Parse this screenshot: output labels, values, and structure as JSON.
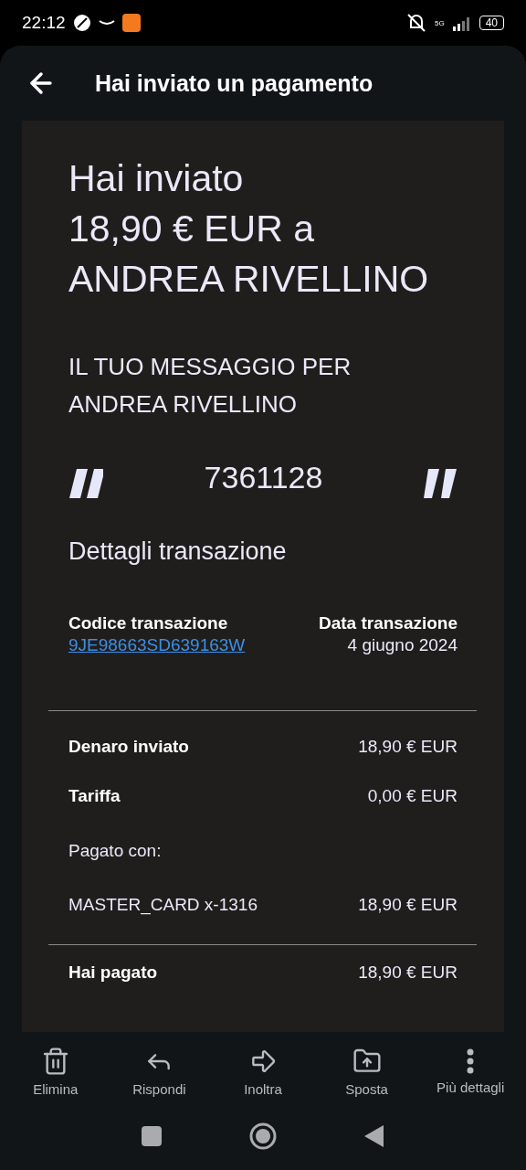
{
  "status_bar": {
    "time": "22:12",
    "battery": "40",
    "network": "5G"
  },
  "header": {
    "title": "Hai inviato un pagamento"
  },
  "summary": {
    "title_lines": [
      "Hai inviato",
      "18,90 € EUR a",
      "ANDREA RIVELLINO"
    ],
    "message_heading_lines": [
      "IL TUO MESSAGGIO PER",
      "ANDREA RIVELLINO"
    ],
    "message": "7361128"
  },
  "details": {
    "heading": "Dettagli transazione",
    "code": {
      "label": "Codice transazione",
      "value": "9JE98663SD639163W"
    },
    "date": {
      "label": "Data transazione",
      "value": "4 giugno 2024"
    },
    "rows": [
      {
        "kind": "bold",
        "label": "Denaro inviato",
        "value": "18,90 € EUR"
      },
      {
        "kind": "bold",
        "label": "Tariffa",
        "value": "0,00 € EUR"
      },
      {
        "kind": "plain",
        "label": "Pagato con:"
      },
      {
        "kind": "plain",
        "label": "MASTER_CARD x-1316",
        "value": "18,90 € EUR"
      },
      {
        "kind": "divider"
      },
      {
        "kind": "bold",
        "label": "Hai pagato",
        "value": "18,90 € EUR"
      }
    ]
  },
  "toolbar": [
    {
      "kind": "delete",
      "label": "Elimina"
    },
    {
      "kind": "reply",
      "label": "Rispondi"
    },
    {
      "kind": "forward",
      "label": "Inoltra"
    },
    {
      "kind": "move",
      "label": "Sposta"
    },
    {
      "kind": "more",
      "label": "Più dettagli"
    }
  ]
}
